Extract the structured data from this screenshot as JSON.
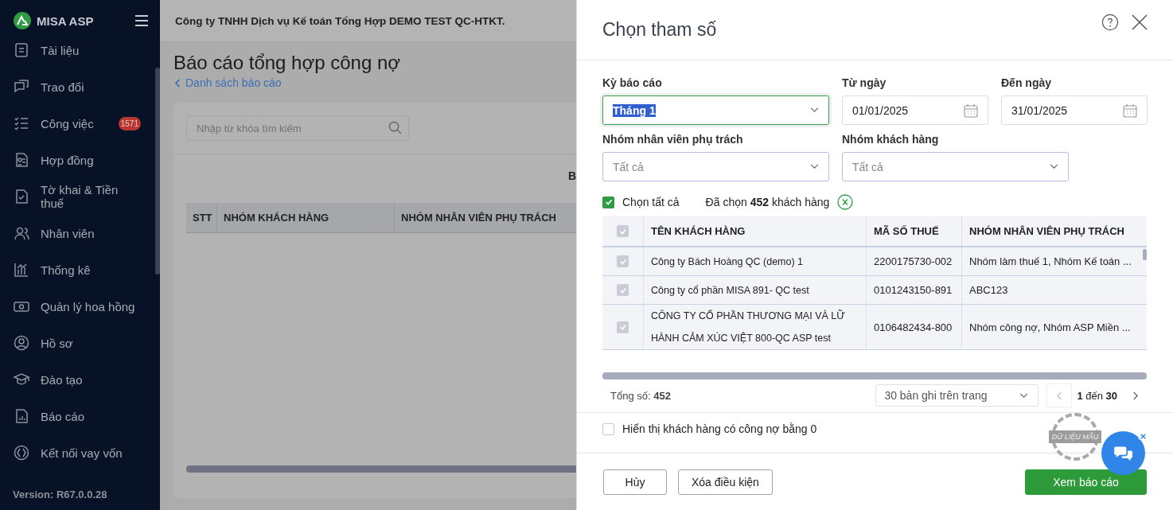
{
  "sidebar": {
    "brand": "MISA ASP",
    "items": [
      {
        "label": "Tài liệu"
      },
      {
        "label": "Trao đổi"
      },
      {
        "label": "Công việc",
        "badge": "1571"
      },
      {
        "label": "Hợp đồng"
      },
      {
        "label": "Tờ khai & Tiền thuế"
      },
      {
        "label": "Nhân viên"
      },
      {
        "label": "Thống kê"
      },
      {
        "label": "Quản lý hoa hồng"
      },
      {
        "label": "Hồ sơ"
      },
      {
        "label": "Đào tạo"
      },
      {
        "label": "Báo cáo"
      },
      {
        "label": "Kết nối vay vốn"
      }
    ],
    "version": "Version: R67.0.0.28"
  },
  "header": {
    "company": "Công ty TNHH Dịch vụ Kế toán Tổng Hợp DEMO TEST QC-HTKT."
  },
  "page": {
    "title": "Báo cáo tổng hợp công nợ",
    "back_link": "Danh sách báo cáo",
    "search": {
      "placeholder": "Nhập từ khóa tìm kiếm"
    },
    "report_title_fragment": "B",
    "table": {
      "columns": [
        "STT",
        "NHÓM KHÁCH HÀNG",
        "NHÓM NHÂN VIÊN PHỤ TRÁCH"
      ]
    }
  },
  "dialog": {
    "title": "Chọn tham số",
    "period": {
      "label": "Kỳ báo cáo",
      "value": "Tháng 1"
    },
    "from_date": {
      "label": "Từ ngày",
      "value": "01/01/2025"
    },
    "to_date": {
      "label": "Đến ngày",
      "value": "31/01/2025"
    },
    "staff_group": {
      "label": "Nhóm nhân viên phụ trách",
      "placeholder": "Tất cả"
    },
    "customer_group": {
      "label": "Nhóm khách hàng",
      "placeholder": "Tất cả"
    },
    "select_all": {
      "label": "Chọn tất cả",
      "checked": true
    },
    "selected_summary": "Đã chọn **452** khách hàng",
    "table": {
      "header_checked": true,
      "columns": [
        "TÊN KHÁCH HÀNG",
        "MÃ SỐ THUẾ",
        "NHÓM NHÂN VIÊN PHỤ TRÁCH"
      ],
      "rows": [
        {
          "checked": true,
          "name": "Công ty Bách Hoàng QC (demo) 1",
          "tax_code": "2200175730-002",
          "staff_group": "Nhóm làm thuế 1, Nhóm Kế toán ..."
        },
        {
          "checked": true,
          "name": "Công ty cổ phần MISA 891- QC test",
          "tax_code": "0101243150-891",
          "staff_group": "ABC123"
        },
        {
          "checked": true,
          "name": "CÔNG TY CỔ PHẦN THƯƠNG MẠI VÀ LỮ HÀNH CẢM XÚC VIỆT 800-QC ASP test",
          "tax_code": "0106482434-800",
          "staff_group": "Nhóm công nợ, Nhóm ASP Miền ..."
        }
      ]
    },
    "total": "Tổng số: **452**",
    "page_size": "30 bản ghi trên trang",
    "page_range": "**1** đến **30**",
    "show_zero_debt": {
      "label": "Hiển thị khách hàng có công nợ bằng 0",
      "checked": false
    },
    "stamp": "DỮ LIỆU MẪU",
    "buttons": {
      "cancel": "Hủy",
      "clear": "Xóa điều kiện",
      "submit": "Xem báo cáo"
    }
  }
}
